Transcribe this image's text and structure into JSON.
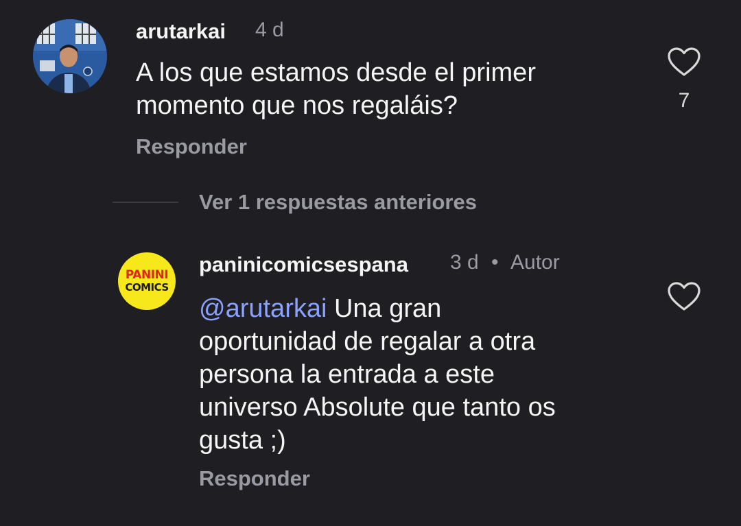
{
  "comment": {
    "username": "arutarkai",
    "time": "4 d",
    "text_line1": "A los que estamos desde el primer",
    "text_line2": "momento que nos regaláis?",
    "reply_label": "Responder",
    "like_count": "7",
    "heart_icon": "heart-outline-icon"
  },
  "replies_toggle": {
    "label": "Ver 1 respuestas anteriores"
  },
  "reply": {
    "username": "paninicomicsespana",
    "time": "3 d",
    "separator": "•",
    "author_badge": "Autor",
    "mention": "@arutarkai",
    "text_line1": " Una gran",
    "text_line2": "oportunidad de regalar a otra",
    "text_line3": "persona la entrada a este",
    "text_line4": "universo Absolute que tanto os",
    "text_line5": "gusta ;)",
    "reply_label": "Responder",
    "heart_icon": "heart-outline-icon",
    "logo_line1": "PANINI",
    "logo_line2": "COMICS"
  },
  "colors": {
    "background": "#1f1f23",
    "text_primary": "#f5f5f5",
    "text_secondary": "#9a9aa2",
    "mention": "#8aa2ff",
    "panini_yellow": "#f6e81a",
    "panini_red": "#e0261b"
  }
}
